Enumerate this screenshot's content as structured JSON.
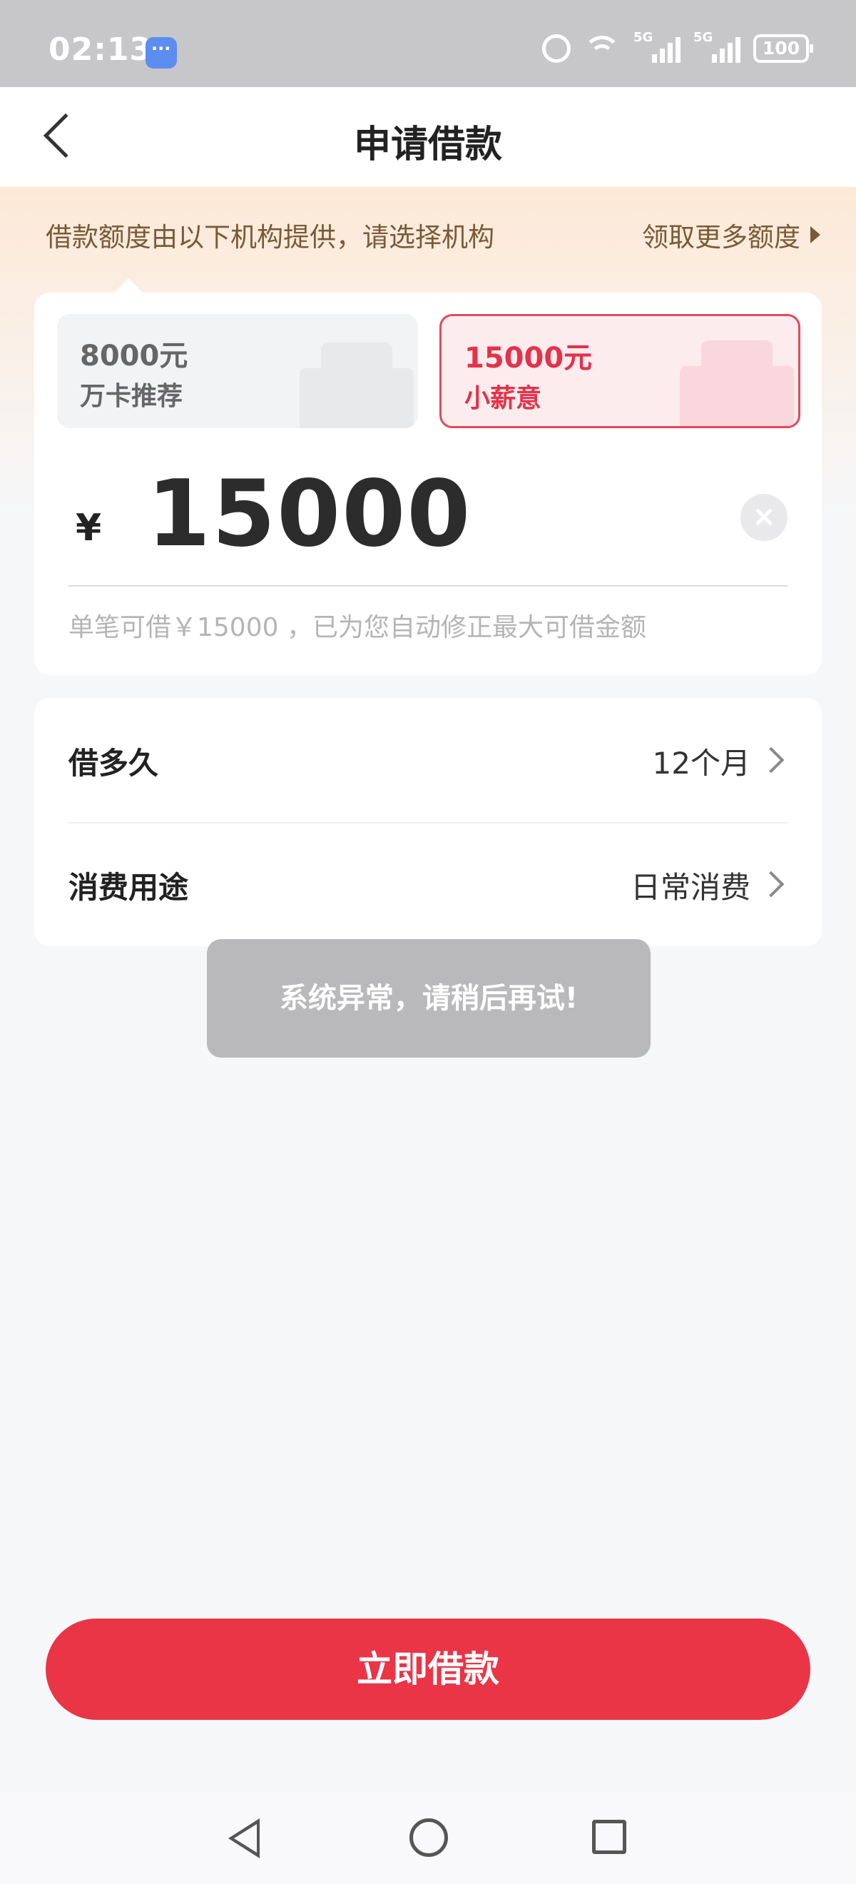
{
  "status_bar": {
    "time": "02:13",
    "network_1": "5G",
    "network_2": "5G",
    "battery": "100",
    "icons": [
      "message-icon",
      "alarm-icon",
      "wifi-icon",
      "signal-icon",
      "battery-icon"
    ]
  },
  "header": {
    "title": "申请借款",
    "back_icon": "back-arrow-icon"
  },
  "notice": {
    "text": "借款额度由以下机构提供，请选择机构",
    "more_link": "领取更多额度"
  },
  "lenders": [
    {
      "amount": "8000元",
      "name": "万卡推荐",
      "selected": false
    },
    {
      "amount": "15000元",
      "name": "小薪意",
      "selected": true
    }
  ],
  "amount": {
    "currency": "¥",
    "value": "15000",
    "hint": "单笔可借￥15000 ，已为您自动修正最大可借金额"
  },
  "form": {
    "rows": [
      {
        "label": "借多久",
        "value": "12个月"
      },
      {
        "label": "消费用途",
        "value": "日常消费"
      }
    ]
  },
  "toast": {
    "text": "系统异常，请稍后再试!"
  },
  "submit": {
    "label": "立即借款"
  },
  "colors": {
    "accent": "#ea3547",
    "selected_border": "#e24a5c",
    "notice_text": "#7a5a37"
  }
}
